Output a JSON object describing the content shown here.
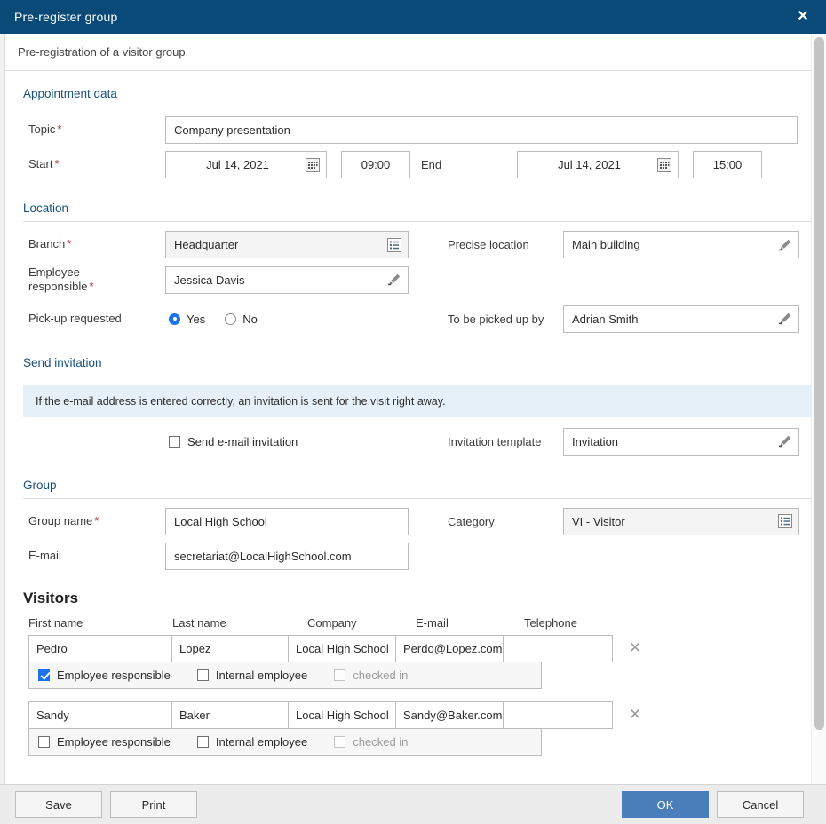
{
  "window": {
    "title": "Pre-register group",
    "close_icon": "close-icon",
    "subtitle": "Pre-registration of a visitor group."
  },
  "sections": {
    "appointment": {
      "heading": "Appointment data",
      "topic_label": "Topic",
      "topic_value": "Company presentation",
      "start_label": "Start",
      "start_date": "Jul 14, 2021",
      "start_time": "09:00",
      "end_label": "End",
      "end_date": "Jul 14, 2021",
      "end_time": "15:00",
      "calendar_icon": "calendar-icon"
    },
    "location": {
      "heading": "Location",
      "branch_label": "Branch",
      "branch_value": "Headquarter",
      "precise_label": "Precise location",
      "precise_value": "Main building",
      "employee_label_line1": "Employee",
      "employee_label_line2": "responsible",
      "employee_value": "Jessica Davis",
      "pickup_label": "Pick-up requested",
      "pickup_yes": "Yes",
      "pickup_no": "No",
      "pickup_selected": "Yes",
      "pickedup_by_label": "To be picked up by",
      "pickedup_by_value": "Adrian Smith",
      "list_icon": "list-picker-icon",
      "pencil_icon": "pencil-icon"
    },
    "invitation": {
      "heading": "Send invitation",
      "info": "If the e-mail address is entered correctly, an invitation is sent for the visit right away.",
      "send_email_label": "Send e-mail invitation",
      "send_email_checked": false,
      "template_label": "Invitation template",
      "template_value": "Invitation"
    },
    "group": {
      "heading": "Group",
      "name_label": "Group name",
      "name_value": "Local High School",
      "category_label": "Category",
      "category_value": "VI - Visitor",
      "email_label": "E-mail",
      "email_value": "secretariat@LocalHighSchool.com"
    },
    "visitors": {
      "heading": "Visitors",
      "columns": [
        "First name",
        "Last name",
        "Company",
        "E-mail",
        "Telephone"
      ],
      "delete_icon": "close-icon",
      "option_labels": {
        "employee_responsible": "Employee responsible",
        "internal_employee": "Internal employee",
        "checked_in": "checked in"
      },
      "rows": [
        {
          "first_name": "Pedro",
          "last_name": "Lopez",
          "company": "Local High School",
          "email": "Perdo@Lopez.com",
          "telephone": "",
          "employee_responsible": true,
          "internal_employee": false,
          "checked_in": false
        },
        {
          "first_name": "Sandy",
          "last_name": "Baker",
          "company": "Local High School",
          "email": "Sandy@Baker.com",
          "telephone": "",
          "employee_responsible": false,
          "internal_employee": false,
          "checked_in": false
        }
      ]
    }
  },
  "footer": {
    "save": "Save",
    "print": "Print",
    "ok": "OK",
    "cancel": "Cancel"
  },
  "colors": {
    "titlebar": "#0a4a78",
    "section_heading": "#15507f",
    "required_star": "#a8202a",
    "accent_blue": "#1a73e8",
    "primary_button": "#4a7ebb",
    "info_banner": "#e6f0f8"
  }
}
